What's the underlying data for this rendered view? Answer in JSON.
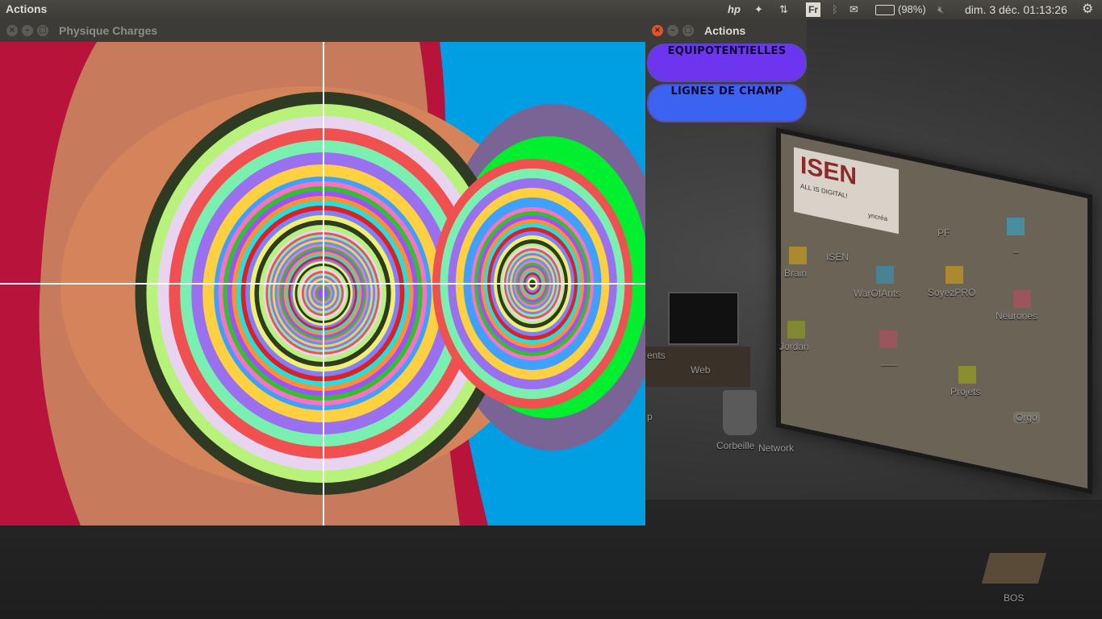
{
  "panel": {
    "app_title": "Actions",
    "keyboard_layout": "Fr",
    "battery": "(98%)",
    "datetime": "dim. 3 déc. 01:13:26",
    "icons": [
      "hp-icon",
      "dropbox-icon",
      "network-transfer-icon",
      "keyboard-icon",
      "bluetooth-icon",
      "mail-icon",
      "battery-icon",
      "volume-muted-icon",
      "gear-icon"
    ]
  },
  "main_window": {
    "title": "Physique Charges",
    "canvas": {
      "description_colors": {
        "background": "#009fe3",
        "outer_red": "#b8133a",
        "salmon": "#c87a5c",
        "orange": "#d4835a",
        "dark_olive": "#2f3a22",
        "lime": "#b8f27a",
        "lilac": "#e8d4f0",
        "violet_halo": "#7a6496",
        "green": "#00f030",
        "axis": "#ffffff"
      }
    }
  },
  "actions_window": {
    "title": "Actions",
    "buttons": {
      "equipotentielles": "EQUIPOTENTIELLES",
      "lignes": "LIGNES DE CHAMP"
    }
  },
  "desktop": {
    "board_logo": "ISEN",
    "board_tagline": "ALL IS DIGITAL!",
    "board_brand": "yncréa",
    "labels": {
      "isen": "ISEN",
      "pf": "PF",
      "brain": "Brain",
      "warofants": "WarOfAnts",
      "soyezpro": "SoyezPRO",
      "dash": "_",
      "neurones": "Neurones",
      "jordan": "Jordan",
      "dash2": "___",
      "projets": "Projets",
      "orgo": "Orgo",
      "web": "Web",
      "ents": "ents",
      "corbeille": "Corbeille",
      "network": "Network",
      "p": "p",
      "bos": "BOS"
    }
  }
}
